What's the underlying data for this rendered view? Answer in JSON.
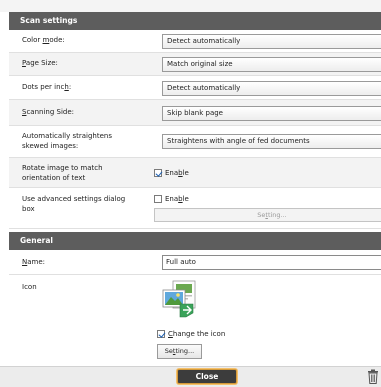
{
  "scan_settings": {
    "header": "Scan settings",
    "color_mode": {
      "label": "Color mode:",
      "value": "Detect automatically"
    },
    "page_size": {
      "label": "Page Size:",
      "value": "Match original size"
    },
    "dpi": {
      "label": "Dots per inch:",
      "value": "Detect automatically"
    },
    "scanning_side": {
      "label": "Scanning Side:",
      "value": "Skip blank page"
    },
    "straighten": {
      "label_line1": "Automatically straightens",
      "label_line2": "skewed images:",
      "value": "Straightens with angle of fed documents"
    },
    "rotate": {
      "label_line1": "Rotate image to match",
      "label_line2": "orientation of text",
      "checkbox_label": "Enable",
      "checked": true
    },
    "advanced": {
      "label_line1": "Use advanced settings dialog",
      "label_line2": "box",
      "checkbox_label": "Enable",
      "checked": false,
      "button_label": "Setting..."
    }
  },
  "general": {
    "header": "General",
    "name": {
      "label": "Name:",
      "value": "Full auto"
    },
    "icon": {
      "label": "Icon",
      "change_label": "Change the icon",
      "checked": true,
      "button_label": "Setting..."
    }
  },
  "footer": {
    "close_label": "Close"
  }
}
